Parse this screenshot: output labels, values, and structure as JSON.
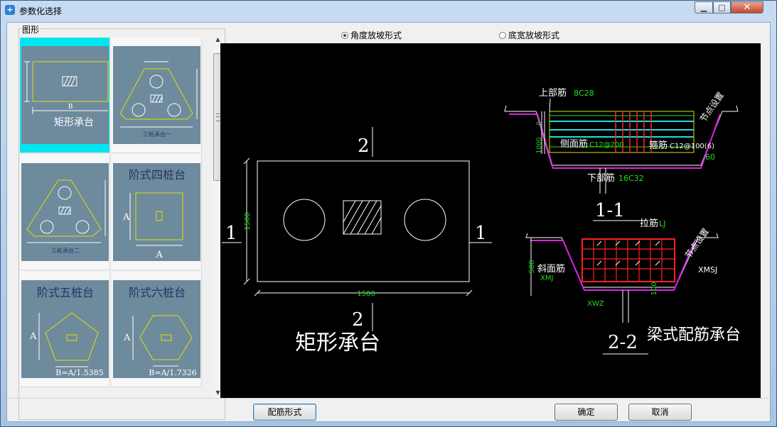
{
  "window": {
    "title": "参数化选择"
  },
  "gallery": {
    "group_label": "图形",
    "items": [
      {
        "label": "矩形承台",
        "dim": "B",
        "selected": true
      },
      {
        "label": "三桩承台一",
        "selected": false
      },
      {
        "label": "三桩承台二",
        "selected": false
      },
      {
        "label": "阶式四桩台",
        "dim_a": "A",
        "dim_b": "A",
        "selected": false
      },
      {
        "label": "阶式五桩台",
        "dim_a": "A",
        "formula": "B=A/1.5385",
        "selected": false
      },
      {
        "label": "阶式六桩台",
        "dim_a": "A",
        "formula": "B=A/1.7326",
        "selected": false
      }
    ]
  },
  "options": {
    "radio1": {
      "label": "角度放坡形式",
      "checked": true
    },
    "radio2": {
      "label": "底宽放坡形式",
      "checked": false
    }
  },
  "preview": {
    "main_title": "矩形承台",
    "section_marks": {
      "top": "2",
      "bottom": "2",
      "left": "1",
      "right": "1"
    },
    "height_dim": "1500",
    "width_dim": "1500",
    "section1": {
      "title": "1-1",
      "top_bar": "上部筋",
      "top_bar_value": "8C28",
      "side_bar": "侧面筋",
      "side_bar_value": "C12@200",
      "stirrup": "箍筋",
      "stirrup_value": "C12@100(6)",
      "bottom_bar": "下部筋",
      "bottom_bar_value": "16C32",
      "node": "节点设置",
      "angle": "60",
      "dim_zero": "0",
      "dim_left": "1000"
    },
    "section2": {
      "title": "2-2",
      "tie_bar": "拉筋",
      "tie_bar_value": "LJ",
      "slope_bar": "斜面筋",
      "slope_bar_value": "XMJ",
      "right_label": "XMSJ",
      "bottom_label": "XWZ",
      "node": "节点设置",
      "dim_500": "500",
      "dim_100": "100"
    },
    "beam_title": "梁式配筋承台"
  },
  "buttons": {
    "rebar": "配筋形式",
    "ok": "确定",
    "cancel": "取消"
  },
  "colors": {
    "canvas_bg": "#000000",
    "selected_item": "#00e6f0",
    "thumb_bg": "#6e8a9d",
    "shape_yellow": "#e0e000",
    "dim_green": "#22dd22",
    "rebar_red": "#ff2020",
    "slope_magenta": "#e020e0"
  }
}
